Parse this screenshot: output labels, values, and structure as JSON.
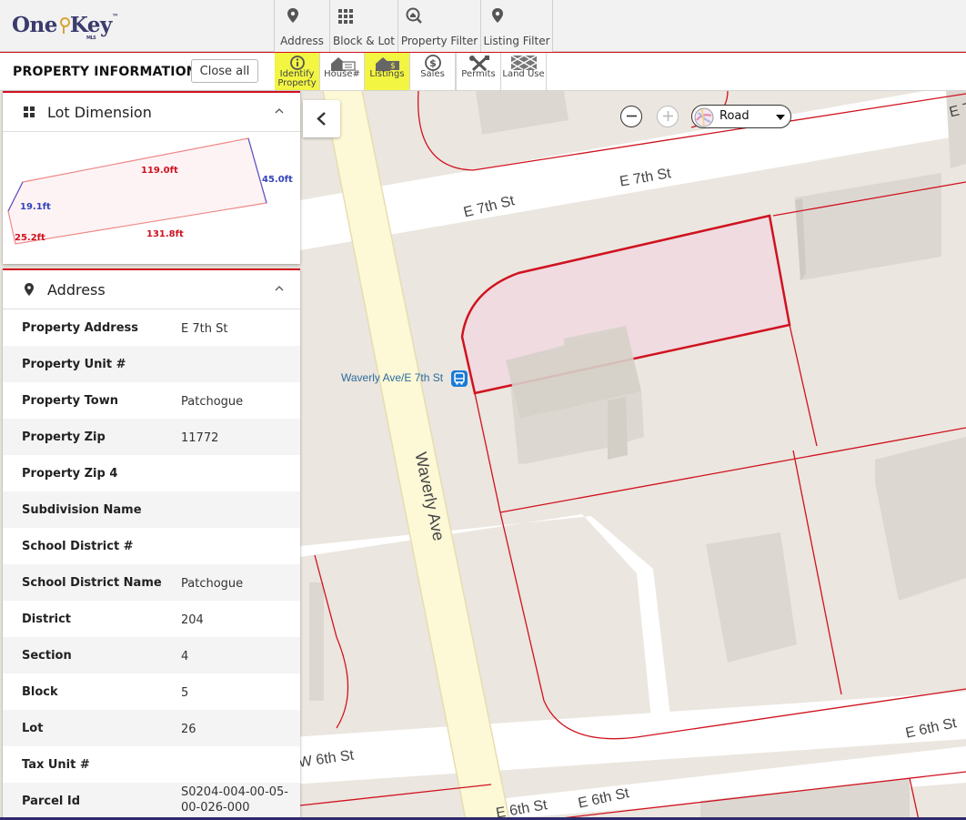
{
  "logo": {
    "text_one": "One",
    "text_key": "Key",
    "tm": "™",
    "mls": "MLS"
  },
  "nav": [
    {
      "label": "Address",
      "icon": "location-pin-icon"
    },
    {
      "label": "Block & Lot",
      "icon": "grid-icon"
    },
    {
      "label": "Property Filter",
      "icon": "magnify-house-icon"
    },
    {
      "label": "Listing Filter",
      "icon": "location-pin-icon"
    }
  ],
  "toolbar": {
    "title": "PROPERTY INFORMATION",
    "close_all": "Close all",
    "tools": [
      {
        "label": "Identify Property",
        "icon": "info-icon",
        "active": true
      },
      {
        "label": "House#",
        "icon": "house-number-icon",
        "active": false
      },
      {
        "label": "Listings",
        "icon": "listings-house-icon",
        "active": true
      },
      {
        "label": "Sales",
        "icon": "dollar-icon",
        "active": false
      },
      {
        "label": "Permits",
        "icon": "tools-icon",
        "active": false
      },
      {
        "label": "Land Use",
        "icon": "land-use-icon",
        "active": false
      }
    ]
  },
  "lot_dimension": {
    "title": "Lot Dimension",
    "edges": {
      "top": "119.0ft",
      "right": "45.0ft",
      "left": "19.1ft",
      "bottom_left": "25.2ft",
      "bottom": "131.8ft"
    }
  },
  "address": {
    "title": "Address",
    "rows": [
      {
        "label": "Property Address",
        "value": "E 7th St"
      },
      {
        "label": "Property Unit #",
        "value": ""
      },
      {
        "label": "Property Town",
        "value": "Patchogue"
      },
      {
        "label": "Property Zip",
        "value": "11772"
      },
      {
        "label": "Property Zip 4",
        "value": ""
      },
      {
        "label": "Subdivision Name",
        "value": ""
      },
      {
        "label": "School District #",
        "value": ""
      },
      {
        "label": "School District Name",
        "value": "Patchogue"
      },
      {
        "label": "District",
        "value": "204"
      },
      {
        "label": "Section",
        "value": "4"
      },
      {
        "label": "Block",
        "value": "5"
      },
      {
        "label": "Lot",
        "value": "26"
      },
      {
        "label": "Tax Unit #",
        "value": ""
      },
      {
        "label": "Parcel Id",
        "value": "S0204-004-00-05-00-026-000"
      }
    ]
  },
  "map": {
    "basemap": "Road",
    "streets": {
      "e7th_a": "E 7th St",
      "e7th_b": "E 7th St",
      "e7th_c": "E 7",
      "waverly": "Waverly Ave",
      "w6th": "W 6th St",
      "e6th_a": "E 6th St",
      "e6th_b": "E 6th St",
      "e6th_c": "E 6th St"
    },
    "bus_stop": "Waverly Ave/E 7th St",
    "colors": {
      "parcel": "#d0121f",
      "selected_fill": "#f0d8e0",
      "road": "#ffffff",
      "avenue": "#fdf8d6",
      "building": "#dcd8d1"
    }
  }
}
